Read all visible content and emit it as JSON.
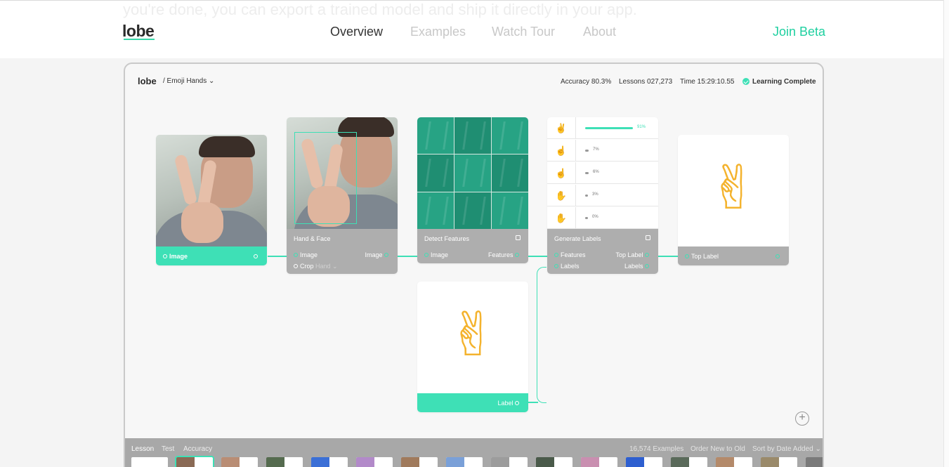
{
  "nav": {
    "ghost_text": "you're done, you can export a trained model and ship it directly in your app.",
    "logo": "lobe",
    "items": [
      "Overview",
      "Examples",
      "Watch Tour",
      "About"
    ],
    "active": "Overview",
    "cta": "Join Beta",
    "accent": "#1fd0a0"
  },
  "app": {
    "logo": "lobe",
    "project": "/ Emoji Hands ⌄",
    "accuracy": "Accuracy 80.3%",
    "lessons": "Lessons 027,273",
    "time": "Time 15:29:10.55",
    "status": "Learning Complete",
    "status_color": "#3ee0b6"
  },
  "nodes": {
    "image": {
      "out_label": "Image"
    },
    "hand_face": {
      "title": "Hand & Face",
      "in_label": "Image",
      "out_label": "Image",
      "crop_label": "Crop",
      "crop_value": "Hand ⌄"
    },
    "detect": {
      "title": "Detect Features",
      "in_label": "Image",
      "out_label": "Features"
    },
    "generate": {
      "title": "Generate Labels",
      "in_features": "Features",
      "in_labels": "Labels",
      "out_top": "Top Label",
      "out_labels": "Labels",
      "rows": [
        {
          "icon": "peace-hand-icon",
          "glyph": "✌",
          "pct": "91%",
          "value": 0.91,
          "color": "#3ee0b6"
        },
        {
          "icon": "rock-hand-icon",
          "glyph": "☝",
          "pct": "7%",
          "value": 0.07,
          "color": "#999999"
        },
        {
          "icon": "ok-hand-icon",
          "glyph": "☝",
          "pct": "6%",
          "value": 0.06,
          "color": "#999999"
        },
        {
          "icon": "open-hand-icon",
          "glyph": "✋",
          "pct": "3%",
          "value": 0.03,
          "color": "#999999"
        },
        {
          "icon": "stop-hand-icon",
          "glyph": "✋",
          "pct": "0%",
          "value": 0.0,
          "color": "#999999"
        }
      ]
    },
    "top_label": {
      "out_label": "Top Label",
      "emoji": "✌"
    },
    "label": {
      "in_label": "Label",
      "emoji": "✌"
    }
  },
  "bottom": {
    "tabs": [
      "Lesson",
      "Test",
      "Accuracy"
    ],
    "active_tab": "Lesson",
    "examples": "16,574 Examples",
    "order": "Order New to Old",
    "sort": "Sort by Date Added ⌄",
    "thumb_count": 16
  }
}
